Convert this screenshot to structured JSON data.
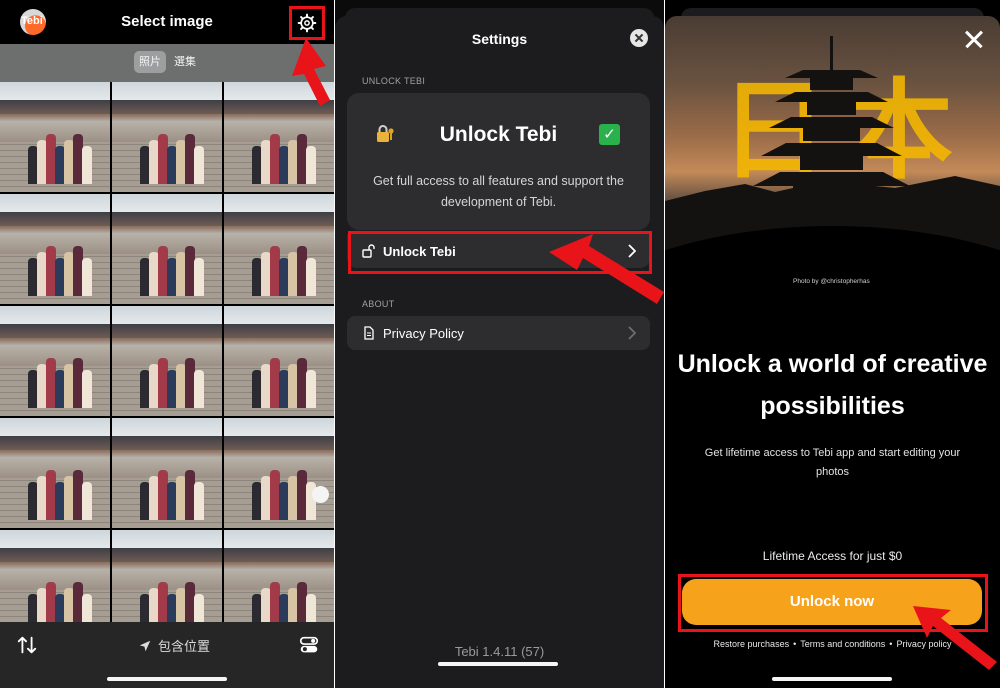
{
  "panel1": {
    "app_logo_text": "Tebi",
    "title": "Select image",
    "segments": [
      "照片",
      "選集"
    ],
    "bottom": {
      "location_label": "包含位置"
    }
  },
  "panel2": {
    "title": "Settings",
    "section_unlock": "UNLOCK TEBI",
    "card": {
      "title": "Unlock Tebi",
      "description": "Get full access to all features and support the development of Tebi."
    },
    "unlock_row_label": "Unlock Tebi",
    "section_about": "ABOUT",
    "privacy_row_label": "Privacy Policy",
    "version": "Tebi 1.4.11 (57)"
  },
  "panel3": {
    "kanji_left": "日",
    "kanji_right": "本",
    "photo_credit": "Photo by @christopherhas",
    "headline": "Unlock a world of creative possibilities",
    "subheadline": "Get lifetime access to Tebi app and start editing your photos",
    "price_text": "Lifetime Access for just $0",
    "cta_label": "Unlock now",
    "footer": {
      "restore": "Restore purchases",
      "terms": "Terms and conditions",
      "privacy": "Privacy policy",
      "separator": "•"
    }
  },
  "colors": {
    "accent_red": "#e8141a",
    "cta_orange": "#f7a21b",
    "gold_text": "#f5b800",
    "sheet_bg": "#1c1c1e",
    "card_bg": "#2d2d2f"
  }
}
